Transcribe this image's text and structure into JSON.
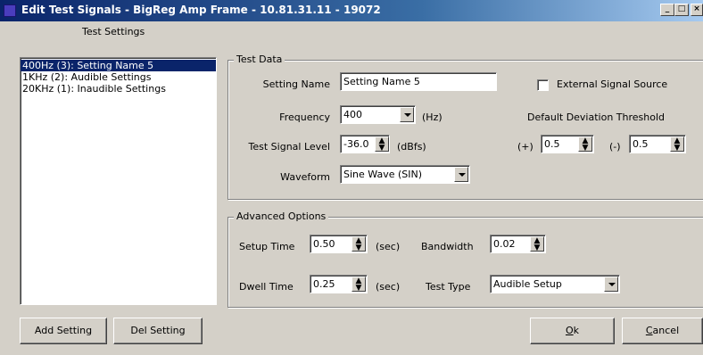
{
  "window": {
    "title": "Edit Test Signals - BigReg Amp Frame - 10.81.31.11 - 19072",
    "minimize_glyph": "_",
    "maximize_glyph": "□",
    "close_glyph": "×"
  },
  "test_settings": {
    "heading": "Test Settings",
    "items": [
      {
        "label": "400Hz (3): Setting Name 5",
        "selected": true
      },
      {
        "label": "1KHz (2): Audible Settings",
        "selected": false
      },
      {
        "label": "20KHz (1): Inaudible Settings",
        "selected": false
      }
    ],
    "add_button": "Add Setting",
    "del_button": "Del Setting"
  },
  "test_data": {
    "group_label": "Test Data",
    "setting_name_label": "Setting Name",
    "setting_name_value": "Setting Name 5",
    "external_source_label": "External Signal Source",
    "external_source_checked": false,
    "frequency_label": "Frequency",
    "frequency_value": "400",
    "frequency_unit": "(Hz)",
    "level_label": "Test Signal Level",
    "level_value": "-36.0",
    "level_unit": "(dBfs)",
    "waveform_label": "Waveform",
    "waveform_value": "Sine Wave (SIN)",
    "deviation_label": "Default Deviation Threshold",
    "plus_label": "(+)",
    "plus_value": "0.5",
    "minus_label": "(-)",
    "minus_value": "0.5"
  },
  "advanced": {
    "group_label": "Advanced Options",
    "setup_time_label": "Setup Time",
    "setup_time_value": "0.50",
    "setup_time_unit": "(sec)",
    "bandwidth_label": "Bandwidth",
    "bandwidth_value": "0.02",
    "dwell_time_label": "Dwell Time",
    "dwell_time_value": "0.25",
    "dwell_time_unit": "(sec)",
    "test_type_label": "Test Type",
    "test_type_value": "Audible Setup"
  },
  "dialog_buttons": {
    "ok": "Ok",
    "cancel": "Cancel"
  },
  "colors": {
    "title_active": "#0a246a",
    "face": "#d4d0c8",
    "selection": "#0a246a"
  }
}
